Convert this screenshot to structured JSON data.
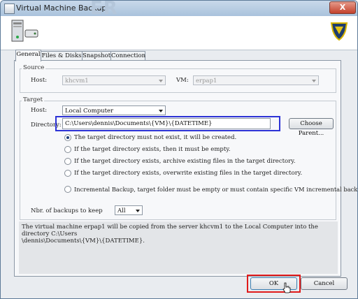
{
  "window": {
    "title": "Virtual Machine Backup",
    "watermark": "ER",
    "close_label": "X"
  },
  "tabs": [
    {
      "label": "General",
      "active": true
    },
    {
      "label": "Files & Disks",
      "active": false
    },
    {
      "label": "Snapshot",
      "active": false
    },
    {
      "label": "Connection",
      "active": false
    }
  ],
  "source": {
    "label": "Source",
    "host_label": "Host:",
    "host_value": "khcvm1",
    "vm_label": "VM:",
    "vm_value": "erpap1"
  },
  "target": {
    "label": "Target",
    "host_label": "Host:",
    "host_value": "Local Computer",
    "directory_label": "Directory:",
    "directory_value": "C:\\Users\\dennis\\Documents\\{VM}\\{DATETIME}",
    "choose_parent_label": "Choose Parent...",
    "options": [
      {
        "label": "The target directory must not exist, it will be created.",
        "checked": true
      },
      {
        "label": "If the target directory exists, then it must be empty.",
        "checked": false
      },
      {
        "label": "If the target directory exists, archive existing files in the target directory.",
        "checked": false
      },
      {
        "label": "If the target directory exists, overwrite existing files in the target directory.",
        "checked": false
      },
      {
        "label": "Incremental Backup, target folder must be empty or must contain specific VM incremental backup",
        "checked": false
      }
    ],
    "backups_label": "Nbr. of backups to keep",
    "backups_value": "All"
  },
  "info": {
    "line1": "The virtual machine erpap1 will be copied from the server khcvm1 to the Local Computer into the directory C:\\Users",
    "line2": "\\dennis\\Documents\\{VM}\\{DATETIME}."
  },
  "buttons": {
    "ok_label": "OK",
    "cancel_label": "Cancel"
  },
  "colors": {
    "highlight_blue": "#2d33d6",
    "highlight_red": "#e01a1a",
    "radio_dot": "#1d3f7a"
  }
}
